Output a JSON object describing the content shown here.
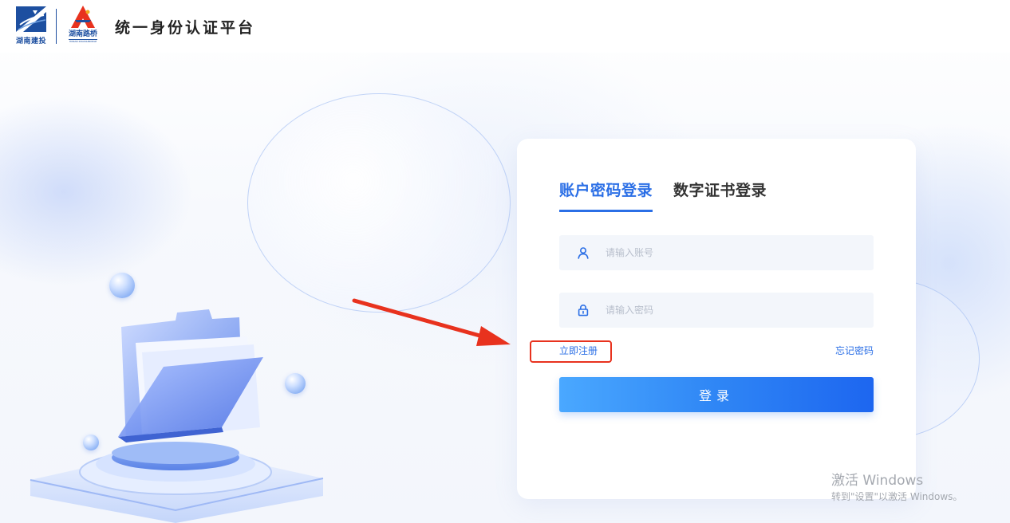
{
  "header": {
    "logo1_text": "湖南建投",
    "logo2_text": "湖南路桥",
    "logo2_sub": "HUNAN ROAD&BRIDGE",
    "title": "统一身份认证平台"
  },
  "login": {
    "tabs": [
      {
        "label": "账户密码登录",
        "active": true
      },
      {
        "label": "数字证书登录",
        "active": false
      }
    ],
    "username": {
      "value": "",
      "placeholder": "请输入账号",
      "icon": "user-icon"
    },
    "password": {
      "value": "",
      "placeholder": "请输入密码",
      "icon": "lock-icon"
    },
    "register_link": "立即注册",
    "forgot_link": "忘记密码",
    "submit_label": "登录"
  },
  "colors": {
    "accent": "#2b6fe6",
    "annotation": "#e8321e"
  },
  "watermark": {
    "line1": "激活 Windows",
    "line2": "转到\"设置\"以激活 Windows。"
  }
}
